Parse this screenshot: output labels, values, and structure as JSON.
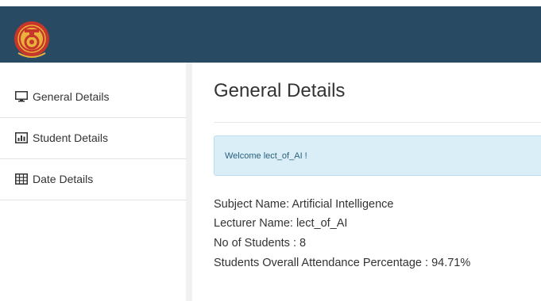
{
  "brand": {
    "primary_color": "#284a63",
    "logo_icon": "institution-crest-icon",
    "logo_ring_text": "BERKHIDMAT UNTUK NEGARA · UNIVERSITI TEKNOLOGI MALAYSIA"
  },
  "sidebar": {
    "items": [
      {
        "label": "General Details",
        "icon": "monitor-icon",
        "active": true
      },
      {
        "label": "Student Details",
        "icon": "bar-chart-icon",
        "active": false
      },
      {
        "label": "Date Details",
        "icon": "table-icon",
        "active": false
      }
    ]
  },
  "main": {
    "title": "General Details",
    "alert": {
      "text": "Welcome lect_of_AI !",
      "color": "#d9eef6"
    },
    "info": {
      "subject": "Subject Name: Artificial Intelligence",
      "lecturer": "Lecturer Name: lect_of_AI",
      "students": "No of Students : 8",
      "attendance": "Students Overall Attendance Percentage : 94.71%"
    }
  }
}
